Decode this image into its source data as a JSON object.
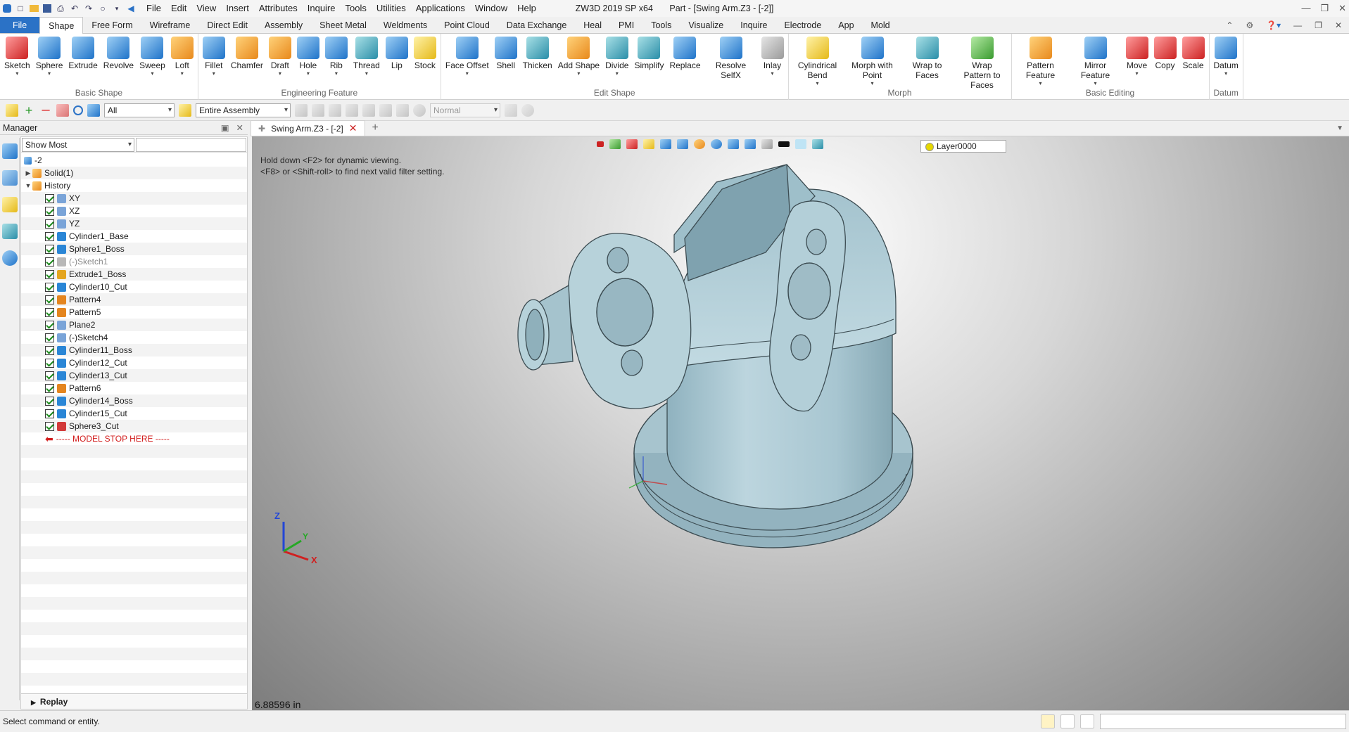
{
  "app": {
    "title_product": "ZW3D 2019 SP x64",
    "title_doc": "Part - [Swing Arm.Z3 - [-2]]",
    "menu": [
      "File",
      "Edit",
      "View",
      "Insert",
      "Attributes",
      "Inquire",
      "Tools",
      "Utilities",
      "Applications",
      "Window",
      "Help"
    ]
  },
  "ribbon_tabs": [
    "File",
    "Shape",
    "Free Form",
    "Wireframe",
    "Direct Edit",
    "Assembly",
    "Sheet Metal",
    "Weldments",
    "Point Cloud",
    "Data Exchange",
    "Heal",
    "PMI",
    "Tools",
    "Visualize",
    "Inquire",
    "Electrode",
    "App",
    "Mold"
  ],
  "active_tab": "Shape",
  "ribbon_groups": [
    {
      "label": "Basic Shape",
      "buttons": [
        {
          "label": "Sketch",
          "icon": "sketch-icon",
          "color": "c-red",
          "caret": true
        },
        {
          "label": "Sphere",
          "icon": "sphere-icon",
          "color": "c-blue",
          "caret": true
        },
        {
          "label": "Extrude",
          "icon": "extrude-icon",
          "color": "c-blue",
          "caret": false
        },
        {
          "label": "Revolve",
          "icon": "revolve-icon",
          "color": "c-blue",
          "caret": false
        },
        {
          "label": "Sweep",
          "icon": "sweep-icon",
          "color": "c-blue",
          "caret": true
        },
        {
          "label": "Loft",
          "icon": "loft-icon",
          "color": "c-orange",
          "caret": true
        }
      ]
    },
    {
      "label": "Engineering Feature",
      "buttons": [
        {
          "label": "Fillet",
          "icon": "fillet-icon",
          "color": "c-blue",
          "caret": true
        },
        {
          "label": "Chamfer",
          "icon": "chamfer-icon",
          "color": "c-orange",
          "caret": false
        },
        {
          "label": "Draft",
          "icon": "draft-icon",
          "color": "c-orange",
          "caret": true
        },
        {
          "label": "Hole",
          "icon": "hole-icon",
          "color": "c-blue",
          "caret": true
        },
        {
          "label": "Rib",
          "icon": "rib-icon",
          "color": "c-blue",
          "caret": true
        },
        {
          "label": "Thread",
          "icon": "thread-icon",
          "color": "c-teal",
          "caret": true
        },
        {
          "label": "Lip",
          "icon": "lip-icon",
          "color": "c-blue",
          "caret": false
        },
        {
          "label": "Stock",
          "icon": "stock-icon",
          "color": "c-yellow",
          "caret": false
        }
      ]
    },
    {
      "label": "Edit Shape",
      "buttons": [
        {
          "label": "Face Offset",
          "icon": "face-offset-icon",
          "color": "c-blue",
          "caret": true
        },
        {
          "label": "Shell",
          "icon": "shell-icon",
          "color": "c-blue",
          "caret": false
        },
        {
          "label": "Thicken",
          "icon": "thicken-icon",
          "color": "c-teal",
          "caret": false
        },
        {
          "label": "Add Shape",
          "icon": "add-shape-icon",
          "color": "c-orange",
          "caret": true
        },
        {
          "label": "Divide",
          "icon": "divide-icon",
          "color": "c-teal",
          "caret": true
        },
        {
          "label": "Simplify",
          "icon": "simplify-icon",
          "color": "c-teal",
          "caret": false
        },
        {
          "label": "Replace",
          "icon": "replace-icon",
          "color": "c-blue",
          "caret": false
        },
        {
          "label": "Resolve SelfX",
          "icon": "resolve-selfx-icon",
          "color": "c-blue",
          "caret": false
        },
        {
          "label": "Inlay",
          "icon": "inlay-icon",
          "color": "c-grey",
          "caret": true
        }
      ]
    },
    {
      "label": "Morph",
      "buttons": [
        {
          "label": "Cylindrical Bend",
          "icon": "cylindrical-bend-icon",
          "color": "c-yellow",
          "caret": true
        },
        {
          "label": "Morph with Point",
          "icon": "morph-point-icon",
          "color": "c-blue",
          "caret": true
        },
        {
          "label": "Wrap to Faces",
          "icon": "wrap-faces-icon",
          "color": "c-teal",
          "caret": false
        },
        {
          "label": "Wrap Pattern to Faces",
          "icon": "wrap-pattern-icon",
          "color": "c-green",
          "caret": false
        }
      ]
    },
    {
      "label": "Basic Editing",
      "buttons": [
        {
          "label": "Pattern Feature",
          "icon": "pattern-feature-icon",
          "color": "c-orange",
          "caret": true
        },
        {
          "label": "Mirror Feature",
          "icon": "mirror-feature-icon",
          "color": "c-blue",
          "caret": true
        },
        {
          "label": "Move",
          "icon": "move-icon",
          "color": "c-red",
          "caret": true
        },
        {
          "label": "Copy",
          "icon": "copy-icon",
          "color": "c-red",
          "caret": false
        },
        {
          "label": "Scale",
          "icon": "scale-icon",
          "color": "c-red",
          "caret": false
        }
      ]
    },
    {
      "label": "Datum",
      "buttons": [
        {
          "label": "Datum",
          "icon": "datum-icon",
          "color": "c-blue",
          "caret": true
        }
      ]
    }
  ],
  "toolbar": {
    "filter_value": "All",
    "scope_value": "Entire Assembly",
    "mode_value": "Normal"
  },
  "manager": {
    "title": "Manager",
    "filter_value": "Show Most",
    "root": "-2",
    "solid": "Solid(1)",
    "history": "History",
    "items": [
      {
        "label": "XY",
        "icon": "datum-plane-icon",
        "color": "#7aa4d8",
        "suppressed": false
      },
      {
        "label": "XZ",
        "icon": "datum-plane-icon",
        "color": "#7aa4d8",
        "suppressed": false
      },
      {
        "label": "YZ",
        "icon": "datum-plane-icon",
        "color": "#7aa4d8",
        "suppressed": false
      },
      {
        "label": "Cylinder1_Base",
        "icon": "cylinder-icon",
        "color": "#2a86d6",
        "suppressed": false
      },
      {
        "label": "Sphere1_Boss",
        "icon": "sphere-icon",
        "color": "#2a86d6",
        "suppressed": false
      },
      {
        "label": "(-)Sketch1",
        "icon": "sketch-icon",
        "color": "#b8b8b8",
        "suppressed": true
      },
      {
        "label": "Extrude1_Boss",
        "icon": "extrude-icon",
        "color": "#e4a51f",
        "suppressed": false
      },
      {
        "label": "Cylinder10_Cut",
        "icon": "cylinder-icon",
        "color": "#2a86d6",
        "suppressed": false
      },
      {
        "label": "Pattern4",
        "icon": "pattern-icon",
        "color": "#e4851f",
        "suppressed": false
      },
      {
        "label": "Pattern5",
        "icon": "pattern-icon",
        "color": "#e4851f",
        "suppressed": false
      },
      {
        "label": "Plane2",
        "icon": "datum-plane-icon",
        "color": "#7aa4d8",
        "suppressed": false
      },
      {
        "label": "(-)Sketch4",
        "icon": "sketch-icon",
        "color": "#7aa4d8",
        "suppressed": false
      },
      {
        "label": "Cylinder11_Boss",
        "icon": "cylinder-icon",
        "color": "#2a86d6",
        "suppressed": false
      },
      {
        "label": "Cylinder12_Cut",
        "icon": "cylinder-icon",
        "color": "#2a86d6",
        "suppressed": false
      },
      {
        "label": "Cylinder13_Cut",
        "icon": "cylinder-icon",
        "color": "#2a86d6",
        "suppressed": false
      },
      {
        "label": "Pattern6",
        "icon": "pattern-icon",
        "color": "#e4851f",
        "suppressed": false
      },
      {
        "label": "Cylinder14_Boss",
        "icon": "cylinder-icon",
        "color": "#2a86d6",
        "suppressed": false
      },
      {
        "label": "Cylinder15_Cut",
        "icon": "cylinder-icon",
        "color": "#2a86d6",
        "suppressed": false
      },
      {
        "label": "Sphere3_Cut",
        "icon": "sphere-icon",
        "color": "#d23a3a",
        "suppressed": false
      }
    ],
    "stop_marker": "----- MODEL STOP HERE -----",
    "replay": "Replay"
  },
  "document": {
    "tab_label": "Swing Arm.Z3 - [-2]",
    "hint_line1": "Hold down <F2> for dynamic viewing.",
    "hint_line2": "<F8> or <Shift-roll> to find next valid filter setting.",
    "layer": "Layer0000",
    "scale_readout": "6.88596 in",
    "axis_x": "X",
    "axis_y": "Y",
    "axis_z": "Z"
  },
  "status": {
    "message": "Select command or entity."
  }
}
